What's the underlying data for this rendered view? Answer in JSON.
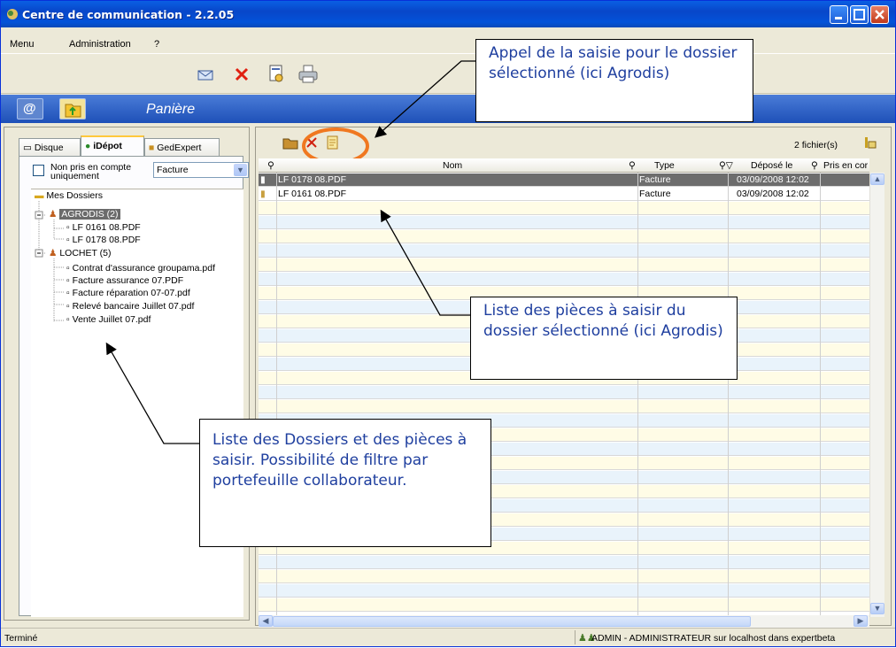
{
  "window": {
    "title": "Centre de communication - 2.2.05"
  },
  "menu": {
    "items": [
      "Menu",
      "Administration",
      "?"
    ]
  },
  "panel": {
    "title": "Panière"
  },
  "tabs": [
    {
      "label": "Disque"
    },
    {
      "label": "iDépot"
    },
    {
      "label": "GedExpert"
    }
  ],
  "filter": {
    "checkbox_label": "Non pris en compte uniquement",
    "select_value": "Facture"
  },
  "tree": {
    "root": "Mes Dossiers",
    "folders": [
      {
        "label": "AGRODIS (2)",
        "files": [
          "LF 0161 08.PDF",
          "LF 0178 08.PDF"
        ]
      },
      {
        "label": "LOCHET (5)",
        "files": [
          "Contrat d'assurance groupama.pdf",
          "Facture assurance 07.PDF",
          "Facture réparation 07-07.pdf",
          "Relevé bancaire Juillet 07.pdf",
          "Vente Juillet 07.pdf"
        ]
      }
    ]
  },
  "grid": {
    "file_count": "2 fichier(s)",
    "columns": [
      "Nom",
      "Type",
      "Déposé le",
      "Pris en cor"
    ],
    "rows": [
      {
        "nom": "LF 0178 08.PDF",
        "type": "Facture",
        "depose": "03/09/2008 12:02"
      },
      {
        "nom": "LF 0161 08.PDF",
        "type": "Facture",
        "depose": "03/09/2008 12:02"
      }
    ]
  },
  "status": {
    "left": "Terminé",
    "right": "ADMIN - ADMINISTRATEUR sur localhost dans expertbeta"
  },
  "callouts": {
    "saisie": "Appel de la saisie pour le dossier sélectionné (ici Agrodis)",
    "liste_pieces": "Liste des pièces à saisir du dossier sélectionné (ici Agrodis)",
    "liste_dossiers": "Liste des Dossiers et des pièces à saisir. Possibilité de filtre par portefeuille collaborateur."
  },
  "colors": {
    "accent": "#f07820",
    "title_blue": "#0a5fe3",
    "callout_text": "#1f3f9f"
  }
}
